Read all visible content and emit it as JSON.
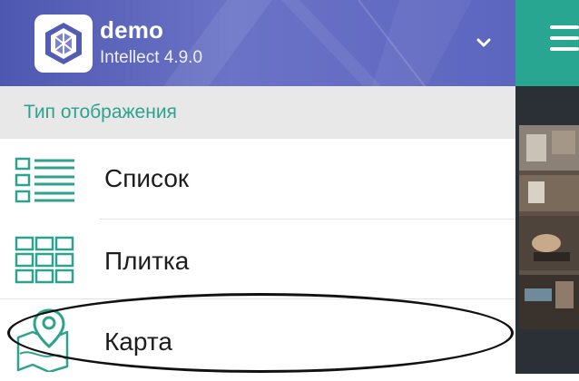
{
  "header": {
    "server_name": "demo",
    "version": "Intellect 4.9.0",
    "colors": {
      "primary": "#4f58b0",
      "accent": "#29a692"
    },
    "logo_icon": "cube-logo-icon",
    "chevron_icon": "chevron-down-icon"
  },
  "section": {
    "label": "Тип отображения"
  },
  "view_modes": [
    {
      "label": "Список",
      "icon": "list-icon"
    },
    {
      "label": "Плитка",
      "icon": "grid-icon"
    },
    {
      "label": "Карта",
      "icon": "map-pin-icon"
    }
  ],
  "right_panel": {
    "menu_icon": "hamburger-icon",
    "camera_preview": "camera-thumbnail"
  }
}
